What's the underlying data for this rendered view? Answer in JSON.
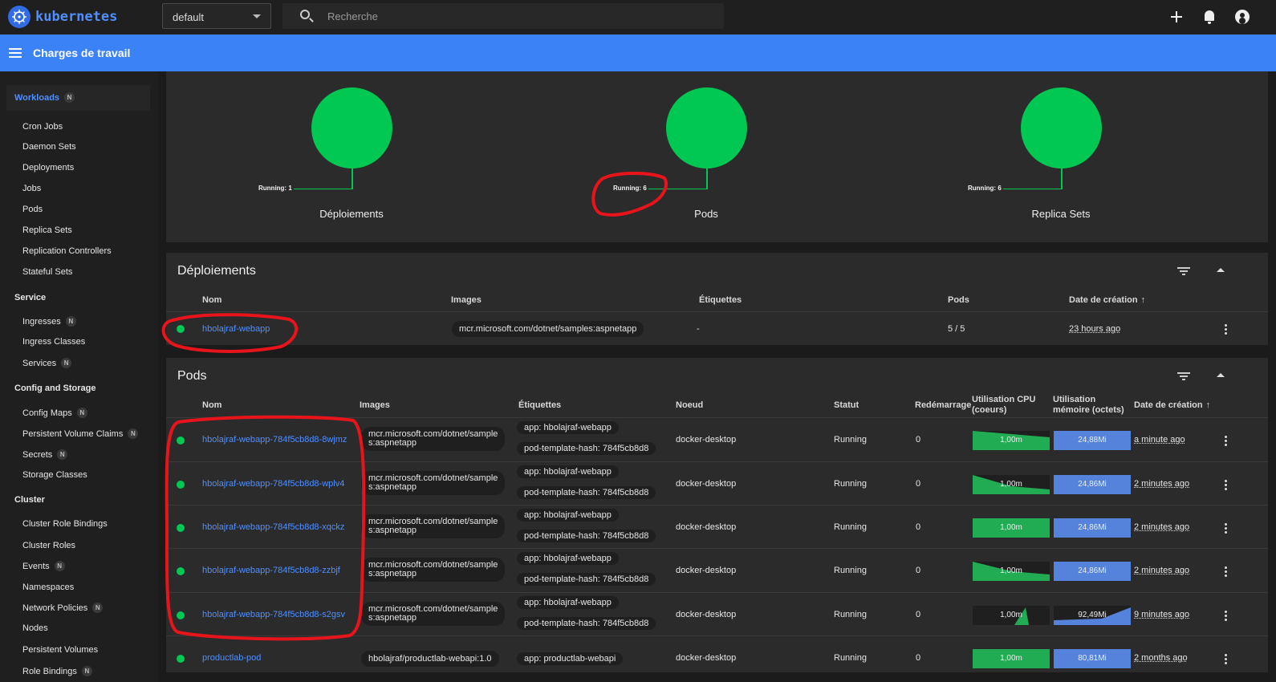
{
  "topbar": {
    "logo_text": "kubernetes",
    "namespace": "default",
    "search_placeholder": "Recherche"
  },
  "header": {
    "title": "Charges de travail"
  },
  "sidebar": {
    "active": {
      "label": "Workloads",
      "badge": "N"
    },
    "workloads": [
      "Cron Jobs",
      "Daemon Sets",
      "Deployments",
      "Jobs",
      "Pods",
      "Replica Sets",
      "Replication Controllers",
      "Stateful Sets"
    ],
    "service_group": "Service",
    "service": [
      {
        "label": "Ingresses",
        "badge": "N"
      },
      {
        "label": "Ingress Classes",
        "badge": ""
      },
      {
        "label": "Services",
        "badge": "N"
      }
    ],
    "config_group": "Config and Storage",
    "config": [
      {
        "label": "Config Maps",
        "badge": "N"
      },
      {
        "label": "Persistent Volume Claims",
        "badge": "N"
      },
      {
        "label": "Secrets",
        "badge": "N"
      },
      {
        "label": "Storage Classes",
        "badge": ""
      }
    ],
    "cluster_group": "Cluster",
    "cluster": [
      {
        "label": "Cluster Role Bindings",
        "badge": ""
      },
      {
        "label": "Cluster Roles",
        "badge": ""
      },
      {
        "label": "Events",
        "badge": "N"
      },
      {
        "label": "Namespaces",
        "badge": ""
      },
      {
        "label": "Network Policies",
        "badge": "N"
      },
      {
        "label": "Nodes",
        "badge": ""
      },
      {
        "label": "Persistent Volumes",
        "badge": ""
      },
      {
        "label": "Role Bindings",
        "badge": "N"
      }
    ]
  },
  "summary": [
    {
      "status": "Running: 1",
      "label": "Déploiements"
    },
    {
      "status": "Running: 6",
      "label": "Pods"
    },
    {
      "status": "Running: 6",
      "label": "Replica Sets"
    }
  ],
  "deployments": {
    "title": "Déploiements",
    "headers": {
      "name": "Nom",
      "images": "Images",
      "labels": "Étiquettes",
      "pods": "Pods",
      "created": "Date de création"
    },
    "sort_arrow": "↑",
    "rows": [
      {
        "name": "hbolajraf-webapp",
        "image": "mcr.microsoft.com/dotnet/samples:aspnetapp",
        "labels": "-",
        "pods": "5 / 5",
        "created": "23 hours ago"
      }
    ]
  },
  "pods": {
    "title": "Pods",
    "headers": {
      "name": "Nom",
      "images": "Images",
      "labels": "Étiquettes",
      "node": "Noeud",
      "status": "Statut",
      "restarts": "Redémarrage",
      "cpu_1": "Utilisation CPU",
      "cpu_2": "(coeurs)",
      "mem_1": "Utilisation",
      "mem_2": "mémoire (octets)",
      "created": "Date de création"
    },
    "sort_arrow": "↑",
    "rows": [
      {
        "name": "hbolajraf-webapp-784f5cb8d8-8wjmz",
        "image_1": "mcr.microsoft.com/dotnet/sample",
        "image_2": "s:aspnetapp",
        "label_1": "app: hbolajraf-webapp",
        "label_2": "pod-template-hash: 784f5cb8d8",
        "node": "docker-desktop",
        "status": "Running",
        "restarts": "0",
        "cpu": "1,00m",
        "mem": "24,88Mi",
        "created": "a minute ago"
      },
      {
        "name": "hbolajraf-webapp-784f5cb8d8-wplv4",
        "image_1": "mcr.microsoft.com/dotnet/sample",
        "image_2": "s:aspnetapp",
        "label_1": "app: hbolajraf-webapp",
        "label_2": "pod-template-hash: 784f5cb8d8",
        "node": "docker-desktop",
        "status": "Running",
        "restarts": "0",
        "cpu": "1,00m",
        "mem": "24,86Mi",
        "created": "2 minutes ago"
      },
      {
        "name": "hbolajraf-webapp-784f5cb8d8-xqckz",
        "image_1": "mcr.microsoft.com/dotnet/sample",
        "image_2": "s:aspnetapp",
        "label_1": "app: hbolajraf-webapp",
        "label_2": "pod-template-hash: 784f5cb8d8",
        "node": "docker-desktop",
        "status": "Running",
        "restarts": "0",
        "cpu": "1,00m",
        "mem": "24,86Mi",
        "created": "2 minutes ago"
      },
      {
        "name": "hbolajraf-webapp-784f5cb8d8-zzbjf",
        "image_1": "mcr.microsoft.com/dotnet/sample",
        "image_2": "s:aspnetapp",
        "label_1": "app: hbolajraf-webapp",
        "label_2": "pod-template-hash: 784f5cb8d8",
        "node": "docker-desktop",
        "status": "Running",
        "restarts": "0",
        "cpu": "1,00m",
        "mem": "24,86Mi",
        "created": "2 minutes ago"
      },
      {
        "name": "hbolajraf-webapp-784f5cb8d8-s2gsv",
        "image_1": "mcr.microsoft.com/dotnet/sample",
        "image_2": "s:aspnetapp",
        "label_1": "app: hbolajraf-webapp",
        "label_2": "pod-template-hash: 784f5cb8d8",
        "node": "docker-desktop",
        "status": "Running",
        "restarts": "0",
        "cpu": "1,00m",
        "mem": "92,49Mi",
        "created": "9 minutes ago"
      },
      {
        "name": "productlab-pod",
        "image_1": "hbolajraf/productlab-webapi:1.0",
        "image_2": "",
        "label_1": "app: productlab-webapi",
        "label_2": "",
        "node": "docker-desktop",
        "status": "Running",
        "restarts": "0",
        "cpu": "1,00m",
        "mem": "80,81Mi",
        "created": "2 months ago"
      }
    ]
  },
  "colors": {
    "accent": "#3b82f6",
    "running": "#00c853",
    "link": "#4f8fff",
    "annotation": "#e8141b"
  }
}
